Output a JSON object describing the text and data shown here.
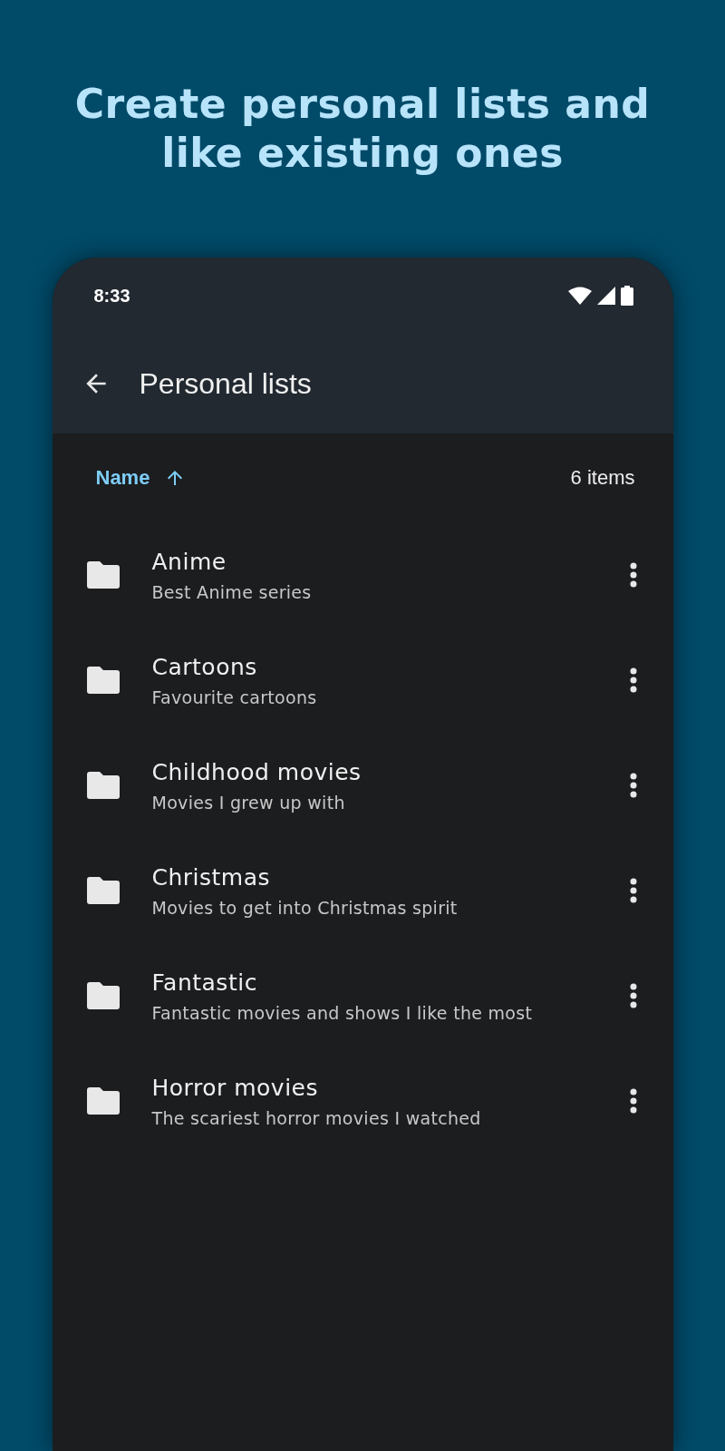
{
  "headline": "Create personal lists and like existing ones",
  "status_bar": {
    "time": "8:33"
  },
  "toolbar": {
    "title": "Personal lists"
  },
  "sort": {
    "label": "Name",
    "count": "6 items"
  },
  "lists": [
    {
      "name": "Anime",
      "description": "Best Anime series"
    },
    {
      "name": "Cartoons",
      "description": "Favourite cartoons"
    },
    {
      "name": "Childhood movies",
      "description": "Movies I grew up with"
    },
    {
      "name": "Christmas",
      "description": "Movies to get into Christmas spirit"
    },
    {
      "name": "Fantastic",
      "description": "Fantastic movies and shows I like the most"
    },
    {
      "name": "Horror movies",
      "description": "The scariest horror movies I watched"
    }
  ]
}
